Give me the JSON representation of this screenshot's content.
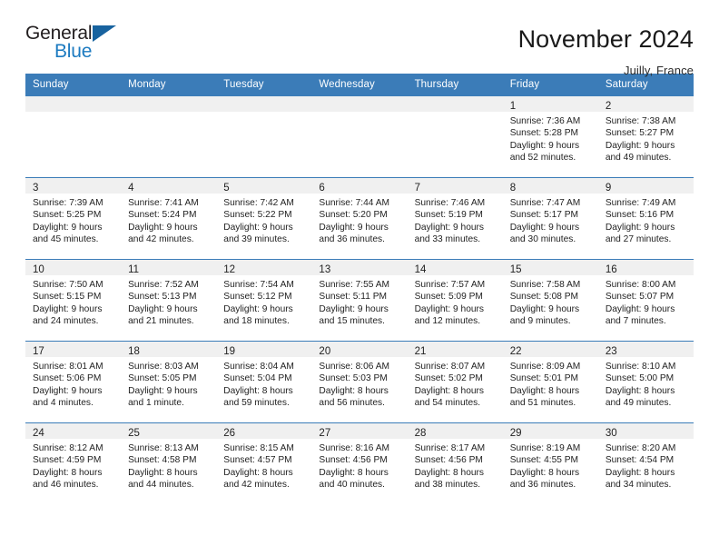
{
  "brand": {
    "name_top": "General",
    "name_bottom": "Blue",
    "accent_color": "#1c7ac0",
    "triangle_color": "#18639f"
  },
  "header": {
    "title": "November 2024",
    "subtitle": "Juilly, France"
  },
  "calendar": {
    "header_bg": "#3b7cb8",
    "day_band_bg": "#f0f0f0",
    "weekdays": [
      "Sunday",
      "Monday",
      "Tuesday",
      "Wednesday",
      "Thursday",
      "Friday",
      "Saturday"
    ],
    "weeks": [
      [
        {
          "day": "",
          "sunrise": "",
          "sunset": "",
          "daylight1": "",
          "daylight2": ""
        },
        {
          "day": "",
          "sunrise": "",
          "sunset": "",
          "daylight1": "",
          "daylight2": ""
        },
        {
          "day": "",
          "sunrise": "",
          "sunset": "",
          "daylight1": "",
          "daylight2": ""
        },
        {
          "day": "",
          "sunrise": "",
          "sunset": "",
          "daylight1": "",
          "daylight2": ""
        },
        {
          "day": "",
          "sunrise": "",
          "sunset": "",
          "daylight1": "",
          "daylight2": ""
        },
        {
          "day": "1",
          "sunrise": "Sunrise: 7:36 AM",
          "sunset": "Sunset: 5:28 PM",
          "daylight1": "Daylight: 9 hours",
          "daylight2": "and 52 minutes."
        },
        {
          "day": "2",
          "sunrise": "Sunrise: 7:38 AM",
          "sunset": "Sunset: 5:27 PM",
          "daylight1": "Daylight: 9 hours",
          "daylight2": "and 49 minutes."
        }
      ],
      [
        {
          "day": "3",
          "sunrise": "Sunrise: 7:39 AM",
          "sunset": "Sunset: 5:25 PM",
          "daylight1": "Daylight: 9 hours",
          "daylight2": "and 45 minutes."
        },
        {
          "day": "4",
          "sunrise": "Sunrise: 7:41 AM",
          "sunset": "Sunset: 5:24 PM",
          "daylight1": "Daylight: 9 hours",
          "daylight2": "and 42 minutes."
        },
        {
          "day": "5",
          "sunrise": "Sunrise: 7:42 AM",
          "sunset": "Sunset: 5:22 PM",
          "daylight1": "Daylight: 9 hours",
          "daylight2": "and 39 minutes."
        },
        {
          "day": "6",
          "sunrise": "Sunrise: 7:44 AM",
          "sunset": "Sunset: 5:20 PM",
          "daylight1": "Daylight: 9 hours",
          "daylight2": "and 36 minutes."
        },
        {
          "day": "7",
          "sunrise": "Sunrise: 7:46 AM",
          "sunset": "Sunset: 5:19 PM",
          "daylight1": "Daylight: 9 hours",
          "daylight2": "and 33 minutes."
        },
        {
          "day": "8",
          "sunrise": "Sunrise: 7:47 AM",
          "sunset": "Sunset: 5:17 PM",
          "daylight1": "Daylight: 9 hours",
          "daylight2": "and 30 minutes."
        },
        {
          "day": "9",
          "sunrise": "Sunrise: 7:49 AM",
          "sunset": "Sunset: 5:16 PM",
          "daylight1": "Daylight: 9 hours",
          "daylight2": "and 27 minutes."
        }
      ],
      [
        {
          "day": "10",
          "sunrise": "Sunrise: 7:50 AM",
          "sunset": "Sunset: 5:15 PM",
          "daylight1": "Daylight: 9 hours",
          "daylight2": "and 24 minutes."
        },
        {
          "day": "11",
          "sunrise": "Sunrise: 7:52 AM",
          "sunset": "Sunset: 5:13 PM",
          "daylight1": "Daylight: 9 hours",
          "daylight2": "and 21 minutes."
        },
        {
          "day": "12",
          "sunrise": "Sunrise: 7:54 AM",
          "sunset": "Sunset: 5:12 PM",
          "daylight1": "Daylight: 9 hours",
          "daylight2": "and 18 minutes."
        },
        {
          "day": "13",
          "sunrise": "Sunrise: 7:55 AM",
          "sunset": "Sunset: 5:11 PM",
          "daylight1": "Daylight: 9 hours",
          "daylight2": "and 15 minutes."
        },
        {
          "day": "14",
          "sunrise": "Sunrise: 7:57 AM",
          "sunset": "Sunset: 5:09 PM",
          "daylight1": "Daylight: 9 hours",
          "daylight2": "and 12 minutes."
        },
        {
          "day": "15",
          "sunrise": "Sunrise: 7:58 AM",
          "sunset": "Sunset: 5:08 PM",
          "daylight1": "Daylight: 9 hours",
          "daylight2": "and 9 minutes."
        },
        {
          "day": "16",
          "sunrise": "Sunrise: 8:00 AM",
          "sunset": "Sunset: 5:07 PM",
          "daylight1": "Daylight: 9 hours",
          "daylight2": "and 7 minutes."
        }
      ],
      [
        {
          "day": "17",
          "sunrise": "Sunrise: 8:01 AM",
          "sunset": "Sunset: 5:06 PM",
          "daylight1": "Daylight: 9 hours",
          "daylight2": "and 4 minutes."
        },
        {
          "day": "18",
          "sunrise": "Sunrise: 8:03 AM",
          "sunset": "Sunset: 5:05 PM",
          "daylight1": "Daylight: 9 hours",
          "daylight2": "and 1 minute."
        },
        {
          "day": "19",
          "sunrise": "Sunrise: 8:04 AM",
          "sunset": "Sunset: 5:04 PM",
          "daylight1": "Daylight: 8 hours",
          "daylight2": "and 59 minutes."
        },
        {
          "day": "20",
          "sunrise": "Sunrise: 8:06 AM",
          "sunset": "Sunset: 5:03 PM",
          "daylight1": "Daylight: 8 hours",
          "daylight2": "and 56 minutes."
        },
        {
          "day": "21",
          "sunrise": "Sunrise: 8:07 AM",
          "sunset": "Sunset: 5:02 PM",
          "daylight1": "Daylight: 8 hours",
          "daylight2": "and 54 minutes."
        },
        {
          "day": "22",
          "sunrise": "Sunrise: 8:09 AM",
          "sunset": "Sunset: 5:01 PM",
          "daylight1": "Daylight: 8 hours",
          "daylight2": "and 51 minutes."
        },
        {
          "day": "23",
          "sunrise": "Sunrise: 8:10 AM",
          "sunset": "Sunset: 5:00 PM",
          "daylight1": "Daylight: 8 hours",
          "daylight2": "and 49 minutes."
        }
      ],
      [
        {
          "day": "24",
          "sunrise": "Sunrise: 8:12 AM",
          "sunset": "Sunset: 4:59 PM",
          "daylight1": "Daylight: 8 hours",
          "daylight2": "and 46 minutes."
        },
        {
          "day": "25",
          "sunrise": "Sunrise: 8:13 AM",
          "sunset": "Sunset: 4:58 PM",
          "daylight1": "Daylight: 8 hours",
          "daylight2": "and 44 minutes."
        },
        {
          "day": "26",
          "sunrise": "Sunrise: 8:15 AM",
          "sunset": "Sunset: 4:57 PM",
          "daylight1": "Daylight: 8 hours",
          "daylight2": "and 42 minutes."
        },
        {
          "day": "27",
          "sunrise": "Sunrise: 8:16 AM",
          "sunset": "Sunset: 4:56 PM",
          "daylight1": "Daylight: 8 hours",
          "daylight2": "and 40 minutes."
        },
        {
          "day": "28",
          "sunrise": "Sunrise: 8:17 AM",
          "sunset": "Sunset: 4:56 PM",
          "daylight1": "Daylight: 8 hours",
          "daylight2": "and 38 minutes."
        },
        {
          "day": "29",
          "sunrise": "Sunrise: 8:19 AM",
          "sunset": "Sunset: 4:55 PM",
          "daylight1": "Daylight: 8 hours",
          "daylight2": "and 36 minutes."
        },
        {
          "day": "30",
          "sunrise": "Sunrise: 8:20 AM",
          "sunset": "Sunset: 4:54 PM",
          "daylight1": "Daylight: 8 hours",
          "daylight2": "and 34 minutes."
        }
      ]
    ]
  }
}
